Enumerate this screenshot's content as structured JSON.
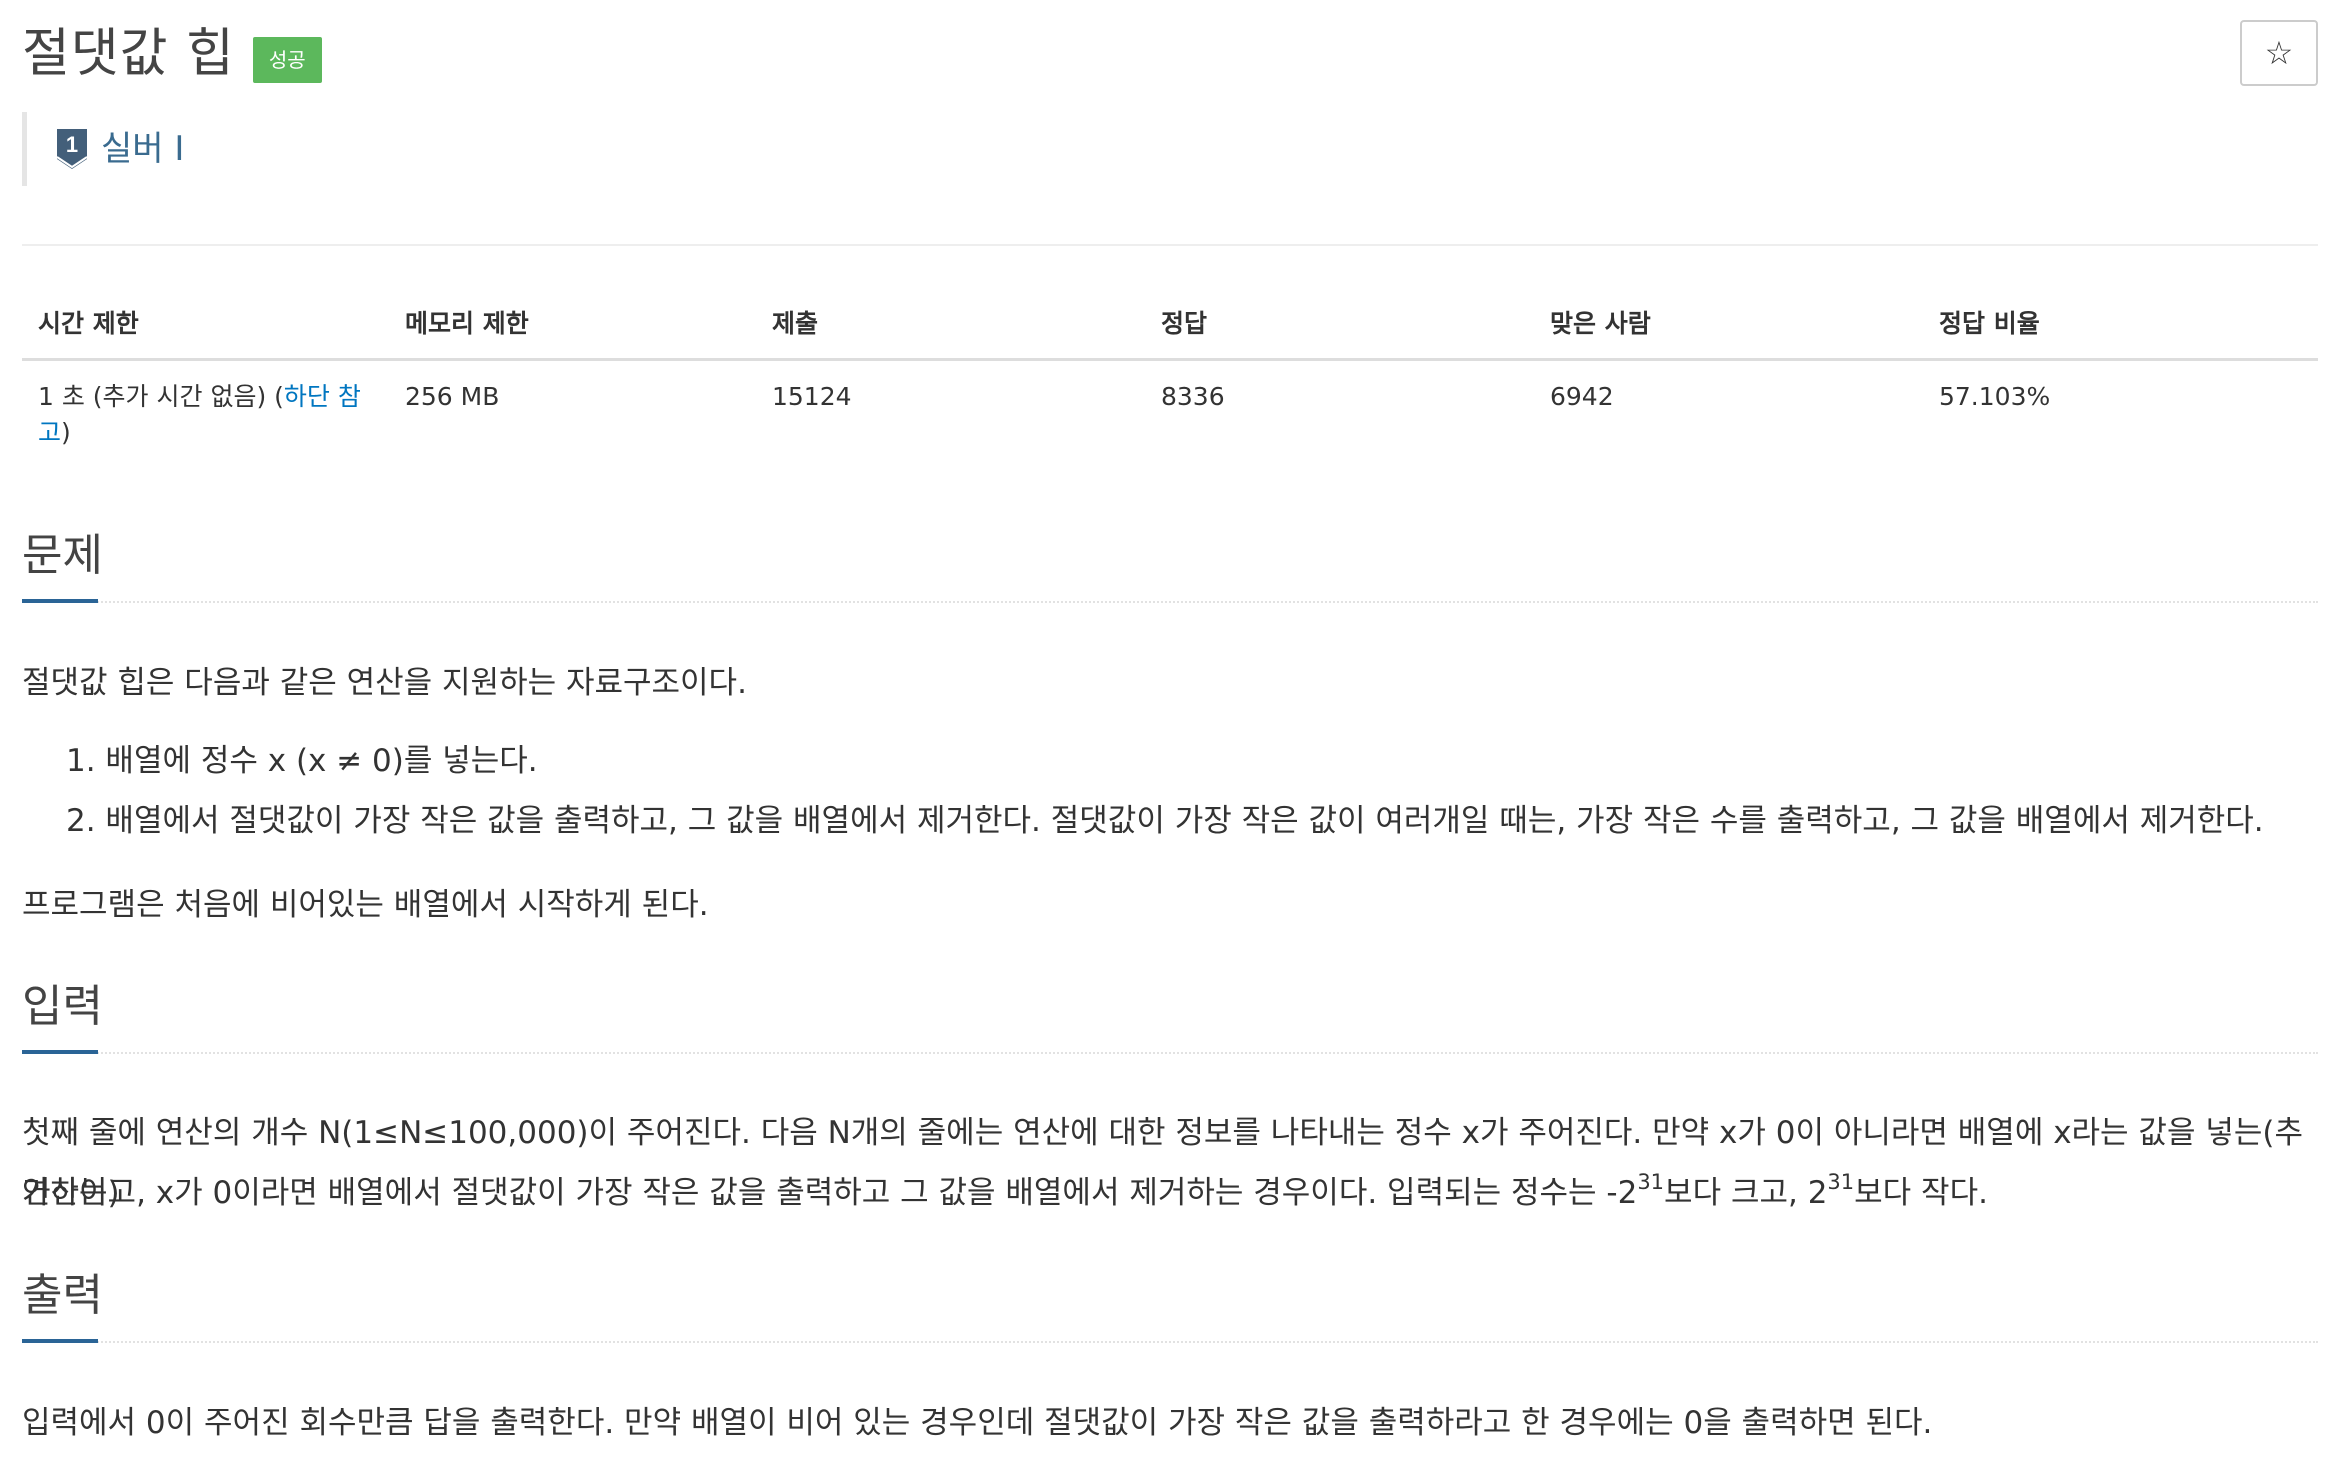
{
  "header": {
    "title": "절댓값 힙",
    "status_badge": "성공",
    "star_label": "☆",
    "tier_number": "1",
    "tier_label": "실버 I"
  },
  "info_table": {
    "headers": [
      "시간 제한",
      "메모리 제한",
      "제출",
      "정답",
      "맞은 사람",
      "정답 비율"
    ],
    "time_limit_prefix": "1 초 (추가 시간 없음) (",
    "time_limit_link": "하단 참고",
    "time_limit_suffix": ")",
    "memory_limit": "256 MB",
    "submissions": "15124",
    "accepted": "8336",
    "solvers": "6942",
    "ratio": "57.103%"
  },
  "problem": {
    "heading": "문제",
    "intro": "절댓값 힙은 다음과 같은 연산을 지원하는 자료구조이다.",
    "items": [
      "1. 배열에 정수 x (x ≠ 0)를 넣는다.",
      "2. 배열에서 절댓값이 가장 작은 값을 출력하고, 그 값을 배열에서 제거한다. 절댓값이 가장 작은 값이 여러개일 때는, 가장 작은 수를 출력하고, 그 값을 배열에서 제거한다."
    ],
    "outro": "프로그램은 처음에 비어있는 배열에서 시작하게 된다."
  },
  "input": {
    "heading": "입력",
    "line1": "첫째 줄에 연산의 개수 N(1≤N≤100,000)이 주어진다. 다음 N개의 줄에는 연산에 대한 정보를 나타내는 정수 x가 주어진다. 만약 x가 0이 아니라면 배열에 x라는 값을 넣는(추가하는)",
    "line2_a": "연산이고, x가 0이라면 배열에서 절댓값이 가장 작은 값을 출력하고 그 값을 배열에서 제거하는 경우이다. 입력되는 정수는 -2",
    "exp1": "31",
    "line2_b": "보다 크고, 2",
    "exp2": "31",
    "line2_c": "보다 작다."
  },
  "output": {
    "heading": "출력",
    "text": "입력에서 0이 주어진 회수만큼 답을 출력한다. 만약 배열이 비어 있는 경우인데 절댓값이 가장 작은 값을 출력하라고 한 경우에는 0을 출력하면 된다."
  },
  "colors": {
    "success": "#5cb85c",
    "link": "#0076c0",
    "tier": "#3a6b8f",
    "section_accent": "#2a6496"
  }
}
